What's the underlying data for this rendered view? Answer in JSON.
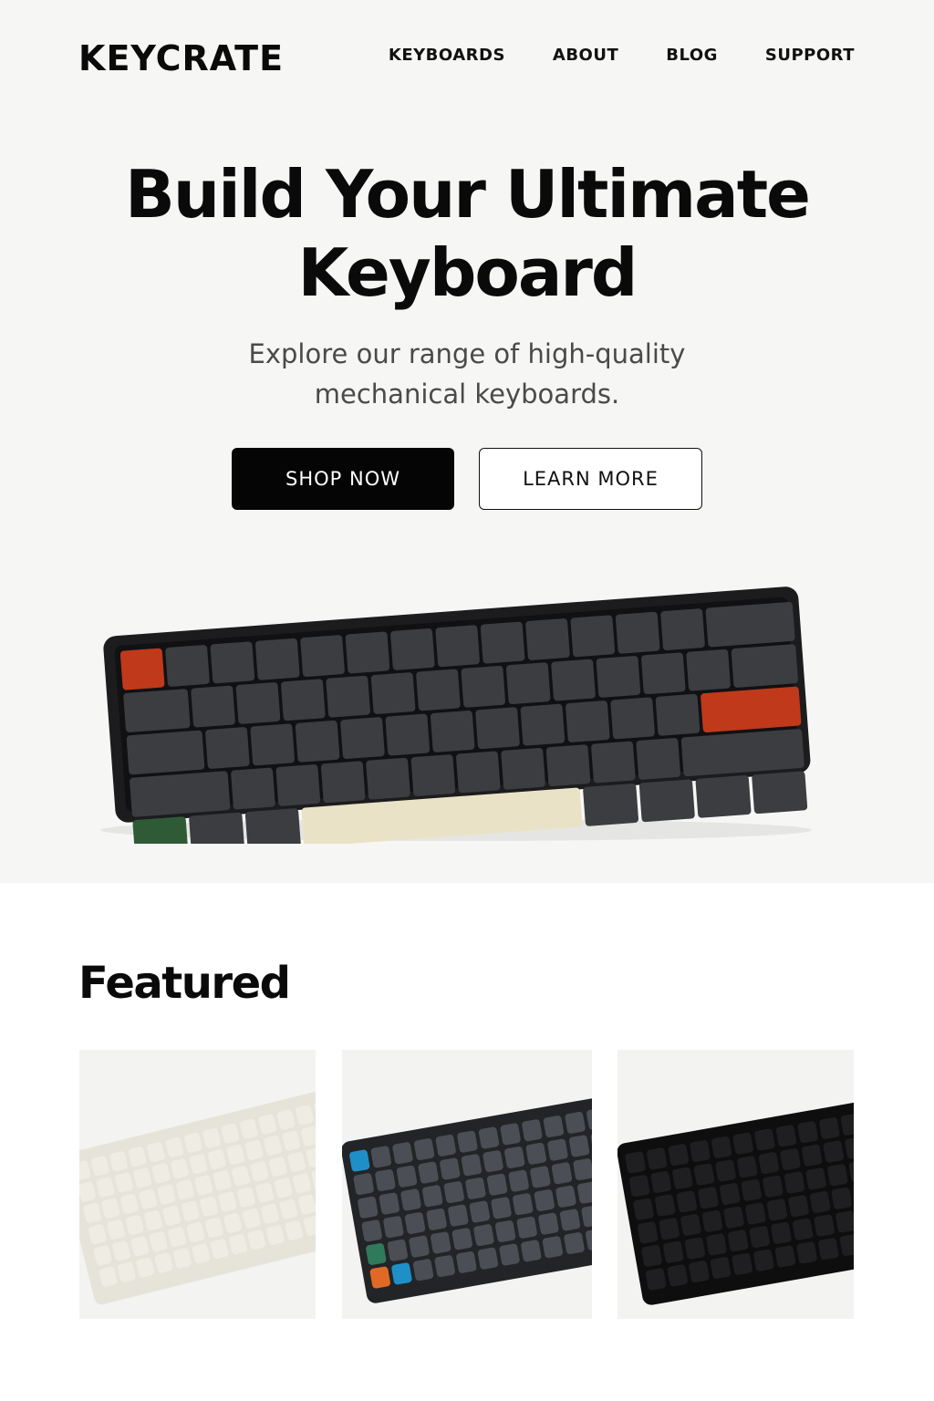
{
  "header": {
    "brand": "KEYCRATE",
    "nav": [
      {
        "label": "KEYBOARDS"
      },
      {
        "label": "ABOUT"
      },
      {
        "label": "BLOG"
      },
      {
        "label": "SUPPORT"
      }
    ]
  },
  "hero": {
    "title_line1": "Build Your Ultimate",
    "title_line2": "Keyboard",
    "subtitle_line1": "Explore our range of high-quality",
    "subtitle_line2": "mechanical keyboards.",
    "primary_button": "SHOP NOW",
    "secondary_button": "LEARN MORE",
    "image": {
      "icon": "mechanical-keyboard-image",
      "case_color": "#1c1c1e",
      "key_color": "#3b3d41",
      "accent_colors": [
        "#c0391b",
        "#2e5b35",
        "#e9e2c6"
      ]
    }
  },
  "featured": {
    "title": "Featured",
    "products": [
      {
        "icon": "cream-keyboard-image",
        "case_color": "#e6e3d9",
        "key_color": "#efece3"
      },
      {
        "icon": "gray-keyboard-image",
        "case_color": "#232427",
        "key_color": "#4b4e54",
        "accent_colors": [
          "#1f8fc8",
          "#2f7a5a",
          "#e06a25"
        ]
      },
      {
        "icon": "black-keyboard-image",
        "case_color": "#0e0e0f",
        "key_color": "#1f1f21"
      }
    ]
  },
  "colors": {
    "hero_background": "#f6f6f4",
    "text": "#0a0a0a",
    "subtext": "#4a4a4a",
    "button_primary": "#050505"
  }
}
